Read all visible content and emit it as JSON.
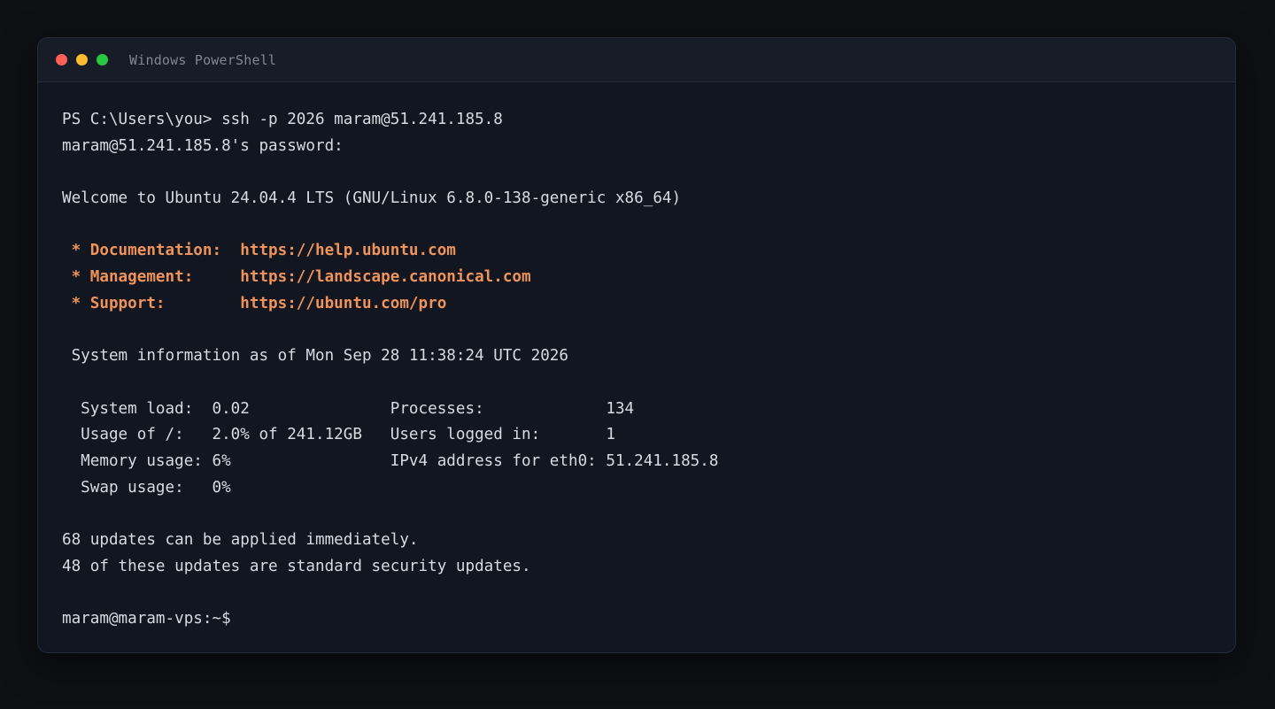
{
  "window": {
    "title": "Windows PowerShell",
    "controls": [
      {
        "name": "close",
        "color": "#ff5f57"
      },
      {
        "name": "minimize",
        "color": "#febc2e"
      },
      {
        "name": "maximize",
        "color": "#28c840"
      }
    ]
  },
  "colors": {
    "background": "#0e1014",
    "terminal_bg": "#111620",
    "text": "#d7dbe2",
    "accent": "#f0935a"
  },
  "terminal": {
    "lines": [
      {
        "text": "PS C:\\Users\\you> ssh -p 2026 maram@51.241.185.8",
        "style": "normal"
      },
      {
        "text": "maram@51.241.185.8's password:",
        "style": "normal"
      },
      {
        "text": "",
        "style": "normal"
      },
      {
        "text": "Welcome to Ubuntu 24.04.4 LTS (GNU/Linux 6.8.0-138-generic x86_64)",
        "style": "normal"
      },
      {
        "text": "",
        "style": "normal"
      },
      {
        "text": " * Documentation:  https://help.ubuntu.com",
        "style": "orange"
      },
      {
        "text": " * Management:     https://landscape.canonical.com",
        "style": "orange"
      },
      {
        "text": " * Support:        https://ubuntu.com/pro",
        "style": "orange"
      },
      {
        "text": "",
        "style": "normal"
      },
      {
        "text": " System information as of Mon Sep 28 11:38:24 UTC 2026",
        "style": "normal"
      },
      {
        "text": "",
        "style": "normal"
      },
      {
        "text": "  System load:  0.02               Processes:             134",
        "style": "normal"
      },
      {
        "text": "  Usage of /:   2.0% of 241.12GB   Users logged in:       1",
        "style": "normal"
      },
      {
        "text": "  Memory usage: 6%                 IPv4 address for eth0: 51.241.185.8",
        "style": "normal"
      },
      {
        "text": "  Swap usage:   0%",
        "style": "normal"
      },
      {
        "text": "",
        "style": "normal"
      },
      {
        "text": "68 updates can be applied immediately.",
        "style": "normal"
      },
      {
        "text": "48 of these updates are standard security updates.",
        "style": "normal"
      },
      {
        "text": "",
        "style": "normal"
      },
      {
        "text": "maram@maram-vps:~$",
        "style": "normal"
      }
    ]
  }
}
